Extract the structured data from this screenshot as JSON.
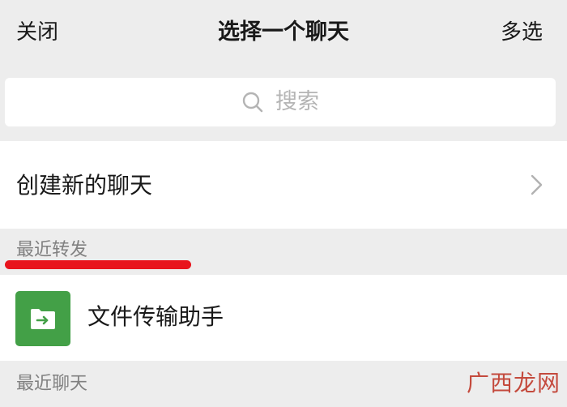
{
  "nav": {
    "close_label": "关闭",
    "title": "选择一个聊天",
    "multi_select_label": "多选"
  },
  "search": {
    "placeholder": "搜索",
    "icon": "search-icon"
  },
  "new_chat": {
    "label": "创建新的聊天",
    "icon": "chevron-right-icon"
  },
  "recent_forward": {
    "header": "最近转发",
    "highlight_color": "#e8141c",
    "items": [
      {
        "label": "文件传输助手",
        "icon": "file-transfer-icon",
        "avatar_color": "#43a047"
      }
    ]
  },
  "recent_chats": {
    "header": "最近聊天"
  },
  "watermark": {
    "text": "广西龙网"
  }
}
